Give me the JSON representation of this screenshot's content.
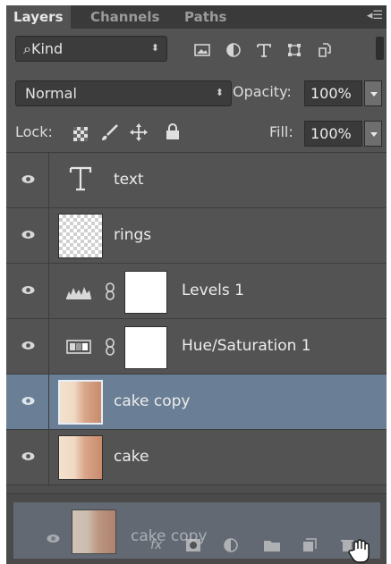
{
  "tabs": [
    "Layers",
    "Channels",
    "Paths"
  ],
  "filter": {
    "label": "Kind",
    "icons": [
      "image-filter-icon",
      "adjustment-filter-icon",
      "type-filter-icon",
      "shape-filter-icon",
      "smart-object-filter-icon"
    ]
  },
  "blend": {
    "mode": "Normal",
    "opacity_label": "Opacity:",
    "opacity_value": "100%"
  },
  "lock": {
    "label": "Lock:",
    "icons": [
      "lock-transparent-pixels-icon",
      "lock-image-pixels-icon",
      "lock-position-icon",
      "lock-all-icon"
    ]
  },
  "fill": {
    "label": "Fill:",
    "value": "100%"
  },
  "layers": [
    {
      "name": "text",
      "kind": "type",
      "visible": true,
      "selected": false
    },
    {
      "name": "rings",
      "kind": "pixel",
      "visible": true,
      "selected": false
    },
    {
      "name": "Levels 1",
      "kind": "adjustment-levels",
      "visible": true,
      "selected": false
    },
    {
      "name": "Hue/Saturation 1",
      "kind": "adjustment-hue-saturation",
      "visible": true,
      "selected": false
    },
    {
      "name": "cake copy",
      "kind": "pixel",
      "visible": true,
      "selected": true
    },
    {
      "name": "cake",
      "kind": "pixel",
      "visible": true,
      "selected": false
    }
  ],
  "drag": {
    "ghost_name": "cake copy"
  },
  "footer_icons": [
    "fx-icon",
    "add-mask-icon",
    "new-adjustment-icon",
    "new-group-icon",
    "new-layer-icon",
    "delete-icon"
  ],
  "colors": {
    "panel": "#535353",
    "selected_row": "#6a7f95"
  }
}
